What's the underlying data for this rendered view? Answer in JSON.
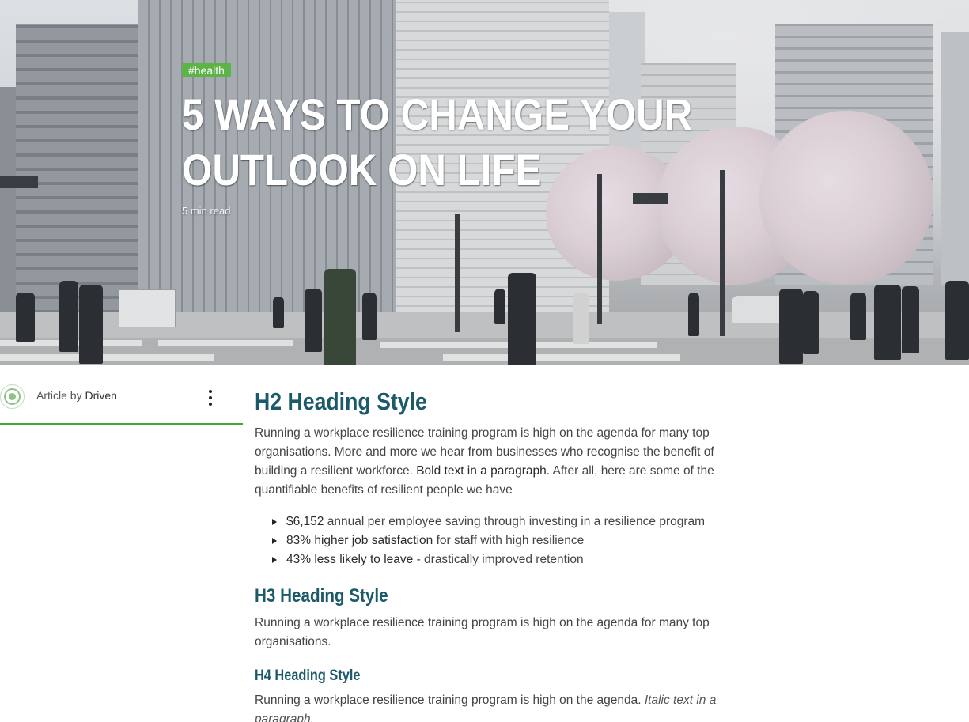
{
  "hero": {
    "tag": "#health",
    "title": "5 WAYS TO CHANGE YOUR OUTLOOK ON LIFE",
    "read_time": "5 min read"
  },
  "author": {
    "prefix": "Article by",
    "name": "Driven",
    "menu_icon": "kebab-menu-icon",
    "avatar_icon": "driven-logo-icon"
  },
  "article": {
    "h2": "H2 Heading Style",
    "intro_before_bold": "Running a workplace resilience training program is high on the agenda for many top organisations. More and more we hear from businesses who recognise the benefit of building a resilient workforce.",
    "intro_bold": "Bold text in a paragraph.",
    "intro_after_bold": "After all, here are some of the quantifiable benefits of resilient people we have",
    "benefits": [
      {
        "strong": "$6,152",
        "rest": "annual per employee saving through investing in a resilience program"
      },
      {
        "strong": "83% higher job satisfaction",
        "rest": "for staff with high resilience"
      },
      {
        "strong": "43% less likely to leave",
        "rest": "- drastically improved retention"
      }
    ],
    "h3": "H3 Heading Style",
    "h3_paragraph": "Running a workplace resilience training program is high on the agenda for many top organisations.",
    "h4": "H4 Heading Style",
    "h4_paragraph": "Running a workplace resilience training program is high on the agenda.",
    "h4_italic": "Italic text in a paragraph."
  },
  "colors": {
    "accent_green": "#5cb346",
    "heading_teal": "#1c5a6a",
    "divider_green": "#4aa33a"
  }
}
